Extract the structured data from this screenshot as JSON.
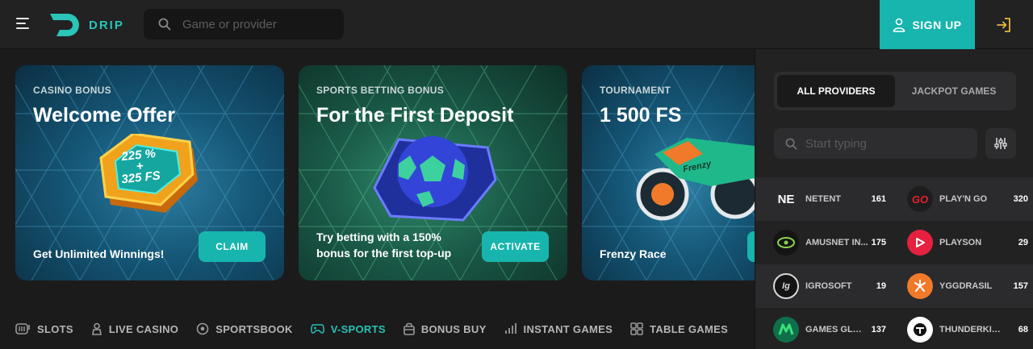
{
  "header": {
    "logo_text": "DRIP",
    "search_placeholder": "Game or provider",
    "signup_label": "SIGN UP"
  },
  "banners": [
    {
      "tag": "CASINO BONUS",
      "title": "Welcome Offer",
      "badge_line1": "225 %",
      "badge_line2": "+",
      "badge_line3": "325 FS",
      "desc": "Get Unlimited Winnings!",
      "button": "CLAIM"
    },
    {
      "tag": "SPORTS BETTING BONUS",
      "title": "For the First Deposit",
      "desc_line1": "Try betting with a 150%",
      "desc_line2": "bonus for the first top-up",
      "button": "ACTIVATE"
    },
    {
      "tag": "TOURNAMENT",
      "title": "1 500 FS",
      "desc": "Frenzy Race",
      "bike_text": "Frenzy"
    }
  ],
  "categories": [
    {
      "label": "SLOTS",
      "icon": "slots-icon",
      "active": false
    },
    {
      "label": "LIVE CASINO",
      "icon": "live-casino-icon",
      "active": false
    },
    {
      "label": "SPORTSBOOK",
      "icon": "sportsbook-icon",
      "active": false
    },
    {
      "label": "V-SPORTS",
      "icon": "vsports-icon",
      "active": true
    },
    {
      "label": "BONUS BUY",
      "icon": "bonus-buy-icon",
      "active": false
    },
    {
      "label": "INSTANT GAMES",
      "icon": "instant-games-icon",
      "active": false
    },
    {
      "label": "TABLE GAMES",
      "icon": "table-games-icon",
      "active": false
    }
  ],
  "panel": {
    "tabs": [
      "ALL PROVIDERS",
      "JACKPOT GAMES"
    ],
    "search_placeholder": "Start typing",
    "providers": [
      {
        "name": "NETENT",
        "count": "161",
        "logo": "NE"
      },
      {
        "name": "PLAY'N GO",
        "count": "320",
        "logo": "GO"
      },
      {
        "name": "AMUSNET IN...",
        "count": "175"
      },
      {
        "name": "PLAYSON",
        "count": "29"
      },
      {
        "name": "IGROSOFT",
        "count": "19",
        "logo": "Ig"
      },
      {
        "name": "YGGDRASIL",
        "count": "157"
      },
      {
        "name": "GAMES GLOB...",
        "count": "137"
      },
      {
        "name": "THUNDERKICK",
        "count": "68"
      }
    ]
  },
  "colors": {
    "accent": "#17b5ad",
    "active_nav": "#27c1b3",
    "logo": "#2bc4b8"
  }
}
